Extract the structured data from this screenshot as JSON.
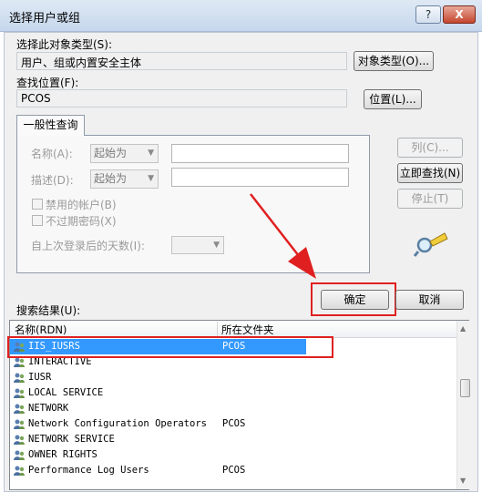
{
  "window": {
    "title": "选择用户或组",
    "help_btn": "?",
    "close_btn": "X"
  },
  "object_type": {
    "label": "选择此对象类型(S):",
    "value": "用户、组或内置安全主体",
    "button": "对象类型(O)..."
  },
  "location": {
    "label": "查找位置(F):",
    "value": "PCOS",
    "button": "位置(L)..."
  },
  "tab": {
    "label": "一般性查询"
  },
  "query": {
    "name_label": "名称(A):",
    "name_mode": "起始为",
    "desc_label": "描述(D):",
    "desc_mode": "起始为",
    "disabled_accounts": "禁用的帐户(B)",
    "no_expire_pwd": "不过期密码(X)",
    "days_label": "自上次登录后的天数(I):"
  },
  "side_buttons": {
    "columns": "列(C)...",
    "find_now": "立即查找(N)",
    "stop": "停止(T)"
  },
  "ok_button": "确定",
  "cancel_button": "取消",
  "results": {
    "label": "搜索结果(U):",
    "headers": [
      "名称(RDN)",
      "所在文件夹"
    ],
    "rows": [
      {
        "name": "IIS_IUSRS",
        "folder": "PCOS",
        "selected": true
      },
      {
        "name": "INTERACTIVE",
        "folder": ""
      },
      {
        "name": "IUSR",
        "folder": ""
      },
      {
        "name": "LOCAL SERVICE",
        "folder": ""
      },
      {
        "name": "NETWORK",
        "folder": ""
      },
      {
        "name": "Network Configuration Operators",
        "folder": "PCOS"
      },
      {
        "name": "NETWORK SERVICE",
        "folder": ""
      },
      {
        "name": "OWNER RIGHTS",
        "folder": ""
      },
      {
        "name": "Performance Log Users",
        "folder": "PCOS"
      }
    ]
  },
  "colors": {
    "selection": "#3399ff",
    "annotation": "#e02020"
  }
}
